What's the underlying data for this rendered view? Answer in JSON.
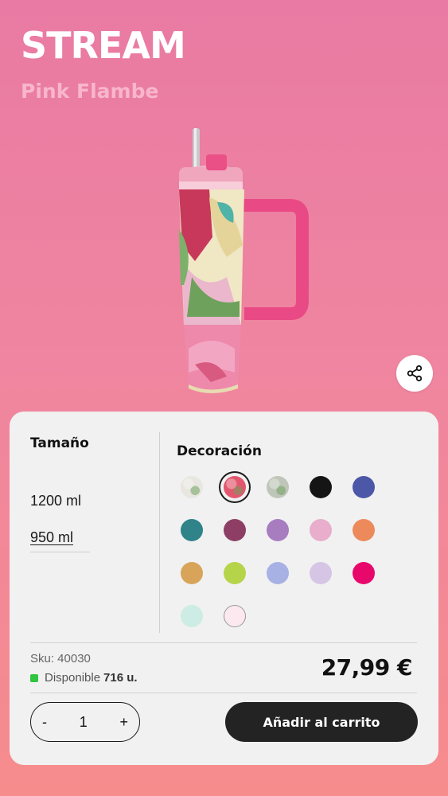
{
  "header": {
    "title": "STREAM",
    "subtitle": "Pink Flambe"
  },
  "product_image": {
    "description_icon": "tumbler-cup-icon",
    "accent_color": "#e8457f"
  },
  "share": {
    "icon": "share-icon"
  },
  "size": {
    "heading": "Tamaño",
    "options": [
      "1200 ml",
      "950 ml"
    ],
    "selected": "950 ml"
  },
  "decoration": {
    "heading": "Decoración",
    "swatches": [
      {
        "color": "#e8e6e0",
        "pattern": true,
        "selected": false
      },
      {
        "color": "#e2566e",
        "pattern": true,
        "selected": true
      },
      {
        "color": "#bfc6b9",
        "pattern": true,
        "selected": false
      },
      {
        "color": "#151515",
        "selected": false
      },
      {
        "color": "#4c57a7",
        "selected": false
      },
      {
        "color": "#2f8389",
        "selected": false
      },
      {
        "color": "#8e3e64",
        "selected": false
      },
      {
        "color": "#a77dc0",
        "selected": false
      },
      {
        "color": "#e8aecb",
        "selected": false
      },
      {
        "color": "#ed8a5b",
        "selected": false
      },
      {
        "color": "#d8a45a",
        "selected": false
      },
      {
        "color": "#b6d449",
        "selected": false
      },
      {
        "color": "#a7b1e4",
        "selected": false
      },
      {
        "color": "#d6c5e5",
        "selected": false
      },
      {
        "color": "#e8086c",
        "selected": false
      },
      {
        "color": "#cdece3",
        "selected": false
      },
      {
        "color": "#fbe9ef",
        "outlined": true,
        "selected": false
      }
    ]
  },
  "details": {
    "sku": "Sku: 40030",
    "availability_label": "Disponible",
    "availability_count": "716 u.",
    "price": "27,99 €"
  },
  "quantity": {
    "minus": "-",
    "value": "1",
    "plus": "+"
  },
  "cart": {
    "label": "Añadir al carrito"
  }
}
